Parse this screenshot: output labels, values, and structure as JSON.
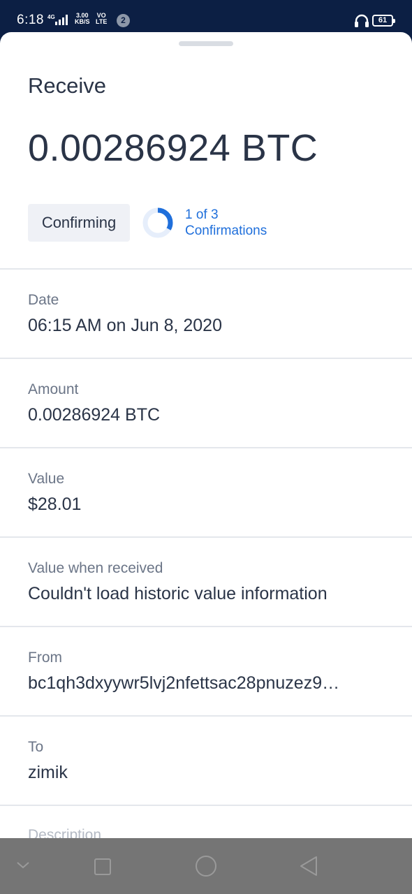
{
  "status_bar": {
    "time": "6:18",
    "network_label": "4G",
    "speed_value": "3.00",
    "speed_unit": "KB/S",
    "volte_top": "VO",
    "volte_bottom": "LTE",
    "notification_count": "2",
    "battery_level": "61"
  },
  "sheet": {
    "title": "Receive",
    "amount": "0.00286924 BTC",
    "status_label": "Confirming",
    "confirmations": {
      "current": 1,
      "required": 3,
      "count_text": "1 of 3",
      "label": "Confirmations"
    },
    "rows": [
      {
        "label": "Date",
        "value": "06:15 AM on Jun 8, 2020"
      },
      {
        "label": "Amount",
        "value": "0.00286924 BTC"
      },
      {
        "label": "Value",
        "value": "$28.01"
      },
      {
        "label": "Value when received",
        "value": "Couldn't load historic value information"
      },
      {
        "label": "From",
        "value": "bc1qh3dxyywr5lvj2nfettsac28pnuzez9…"
      },
      {
        "label": "To",
        "value": "zimik"
      }
    ],
    "partial_label": "Description"
  },
  "colors": {
    "status_bar_bg": "#0c1f44",
    "text_primary": "#2a3447",
    "text_secondary": "#6b7587",
    "accent_blue": "#1f6fdb",
    "pill_bg": "#eff1f6",
    "divider": "#e4e7ec",
    "nav_bar_bg": "#757575"
  },
  "icons": {
    "signal": "signal-bars-icon",
    "headphones": "headphones-icon",
    "battery": "battery-icon",
    "progress": "progress-ring-icon",
    "nav_down": "chevron-down-icon",
    "nav_recents": "square-icon",
    "nav_home": "circle-icon",
    "nav_back": "triangle-back-icon"
  }
}
